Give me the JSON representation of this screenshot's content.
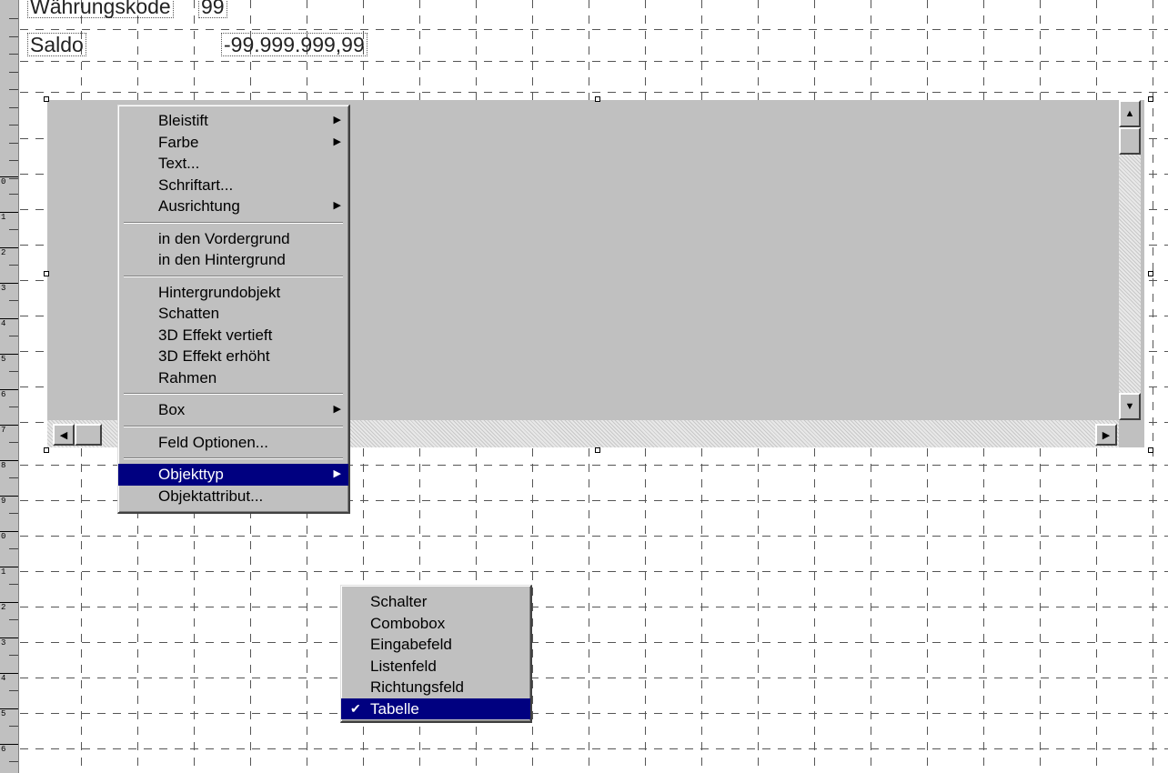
{
  "fields": {
    "currency_label": "Währungskode",
    "currency_value": "99",
    "saldo_label": "Saldo",
    "saldo_value": "-99.999.999,99"
  },
  "ruler": {
    "numbers": [
      "0",
      "1",
      "2",
      "3",
      "4",
      "5",
      "6",
      "7",
      "8",
      "9",
      "0",
      "1",
      "2",
      "3",
      "4",
      "5",
      "6"
    ]
  },
  "context_menu": {
    "items": [
      {
        "label": "Bleistift",
        "submenu": true
      },
      {
        "label": "Farbe",
        "submenu": true
      },
      {
        "label": "Text...",
        "submenu": false
      },
      {
        "label": "Schriftart...",
        "submenu": false
      },
      {
        "label": "Ausrichtung",
        "submenu": true
      },
      {
        "separator": true
      },
      {
        "label": "in den Vordergrund",
        "submenu": false
      },
      {
        "label": "in den Hintergrund",
        "submenu": false
      },
      {
        "separator": true
      },
      {
        "label": "Hintergrundobjekt",
        "submenu": false
      },
      {
        "label": "Schatten",
        "submenu": false
      },
      {
        "label": "3D Effekt vertieft",
        "submenu": false
      },
      {
        "label": "3D Effekt erhöht",
        "submenu": false
      },
      {
        "label": "Rahmen",
        "submenu": false
      },
      {
        "separator": true
      },
      {
        "label": "Box",
        "submenu": true
      },
      {
        "separator": true
      },
      {
        "label": "Feld Optionen...",
        "submenu": false
      },
      {
        "separator": true
      },
      {
        "label": "Objekttyp",
        "submenu": true,
        "selected": true
      },
      {
        "label": "Objektattribut...",
        "submenu": false
      }
    ]
  },
  "submenu": {
    "items": [
      {
        "label": "Schalter",
        "checked": false
      },
      {
        "label": "Combobox",
        "checked": false
      },
      {
        "label": "Eingabefeld",
        "checked": false
      },
      {
        "label": "Listenfeld",
        "checked": false
      },
      {
        "label": "Richtungsfeld",
        "checked": false
      },
      {
        "label": "Tabelle",
        "checked": true
      }
    ]
  },
  "icons": {
    "submenu_arrow": "triangle-right-icon",
    "check": "checkmark-icon",
    "scroll_up": "triangle-up-icon",
    "scroll_down": "triangle-down-icon",
    "scroll_left": "triangle-left-icon",
    "scroll_right": "triangle-right-icon"
  },
  "colors": {
    "selection": "#000080",
    "menu_face": "#c0c0c0",
    "object_fill": "#c0c0c0"
  }
}
